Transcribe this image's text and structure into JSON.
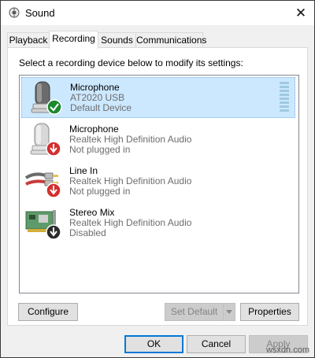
{
  "window": {
    "title": "Sound",
    "close_glyph": "✕"
  },
  "tabs": [
    {
      "label": "Playback",
      "active": false
    },
    {
      "label": "Recording",
      "active": true
    },
    {
      "label": "Sounds",
      "active": false
    },
    {
      "label": "Communications",
      "active": false
    }
  ],
  "panel": {
    "instruction": "Select a recording device below to modify its settings:",
    "devices": [
      {
        "name": "Microphone",
        "hardware": "AT2020 USB",
        "status": "Default Device",
        "icon": "microphone-icon",
        "badge": "check-badge-icon",
        "selected": true
      },
      {
        "name": "Microphone",
        "hardware": "Realtek High Definition Audio",
        "status": "Not plugged in",
        "icon": "microphone-icon",
        "badge": "unplugged-badge-icon",
        "selected": false
      },
      {
        "name": "Line In",
        "hardware": "Realtek High Definition Audio",
        "status": "Not plugged in",
        "icon": "line-in-icon",
        "badge": "unplugged-badge-icon",
        "selected": false
      },
      {
        "name": "Stereo Mix",
        "hardware": "Realtek High Definition Audio",
        "status": "Disabled",
        "icon": "sound-card-icon",
        "badge": "disabled-badge-icon",
        "selected": false
      }
    ],
    "buttons": {
      "configure": "Configure",
      "set_default": "Set Default",
      "properties": "Properties"
    }
  },
  "footer": {
    "ok": "OK",
    "cancel": "Cancel",
    "apply": "Apply"
  },
  "watermark": "wsxdn.com",
  "colors": {
    "selection": "#cce8ff",
    "accent": "#0078d7",
    "badge_green": "#1a8a2e",
    "badge_red": "#d32f2f"
  }
}
